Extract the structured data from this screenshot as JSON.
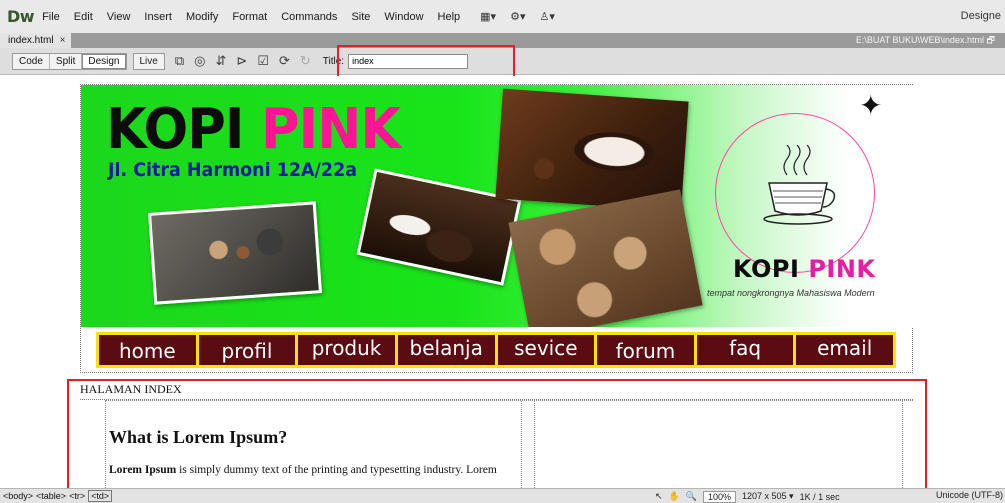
{
  "app": {
    "logo": "Dw",
    "menu": [
      "File",
      "Edit",
      "View",
      "Insert",
      "Modify",
      "Format",
      "Commands",
      "Site",
      "Window",
      "Help"
    ],
    "menu_icons": [
      "▦▾",
      "⚙▾",
      "♙▾"
    ],
    "workspace": "Designe"
  },
  "document": {
    "tab_label": "index.html",
    "close_label": "×",
    "path": "E:\\BUAT BUKU\\WEB\\index.html",
    "restore_icon": "🗗"
  },
  "toolbar": {
    "views": [
      "Code",
      "Split",
      "Design"
    ],
    "live_label": "Live",
    "icons": [
      "⧉",
      "◎",
      "⇵",
      "⊳",
      "☑",
      "⟳",
      "↻"
    ],
    "title_label": "Title:",
    "title_value": "index"
  },
  "page": {
    "banner": {
      "brand_black": "KOPI",
      "brand_pink": "PINK",
      "address": "Jl. Citra Harmoni 12A/22a",
      "logo_black": "KOPI",
      "logo_pink": "PINK",
      "tagline": "tempat nongkrongnya Mahasiswa Modern",
      "sparkle": "✦"
    },
    "nav": [
      {
        "label": "home"
      },
      {
        "label": "profil"
      },
      {
        "label": "produk"
      },
      {
        "label": "belanja"
      },
      {
        "label": "sevice"
      },
      {
        "label": "forum"
      },
      {
        "label": "faq"
      },
      {
        "label": "email"
      }
    ],
    "section_title": "HALAMAN INDEX",
    "article": {
      "heading": "What is Lorem Ipsum?",
      "para_bold": "Lorem Ipsum",
      "para_rest": " is simply dummy text of the printing and typesetting industry. Lorem"
    }
  },
  "statusbar": {
    "tags": [
      "<body>",
      "<table>",
      "<tr>",
      "<td>"
    ],
    "tools": [
      "↖",
      "✋",
      "🔍"
    ],
    "zoom": "100%",
    "window_size": "1207 x 505 ▾",
    "download": "1K / 1 sec",
    "encoding": "Unicode (UTF-8)"
  },
  "colors": {
    "highlight_box": "#e0202a",
    "nav_background": "#5a0c12",
    "nav_border": "#ffe100",
    "brand_pink": "#ff1493"
  }
}
